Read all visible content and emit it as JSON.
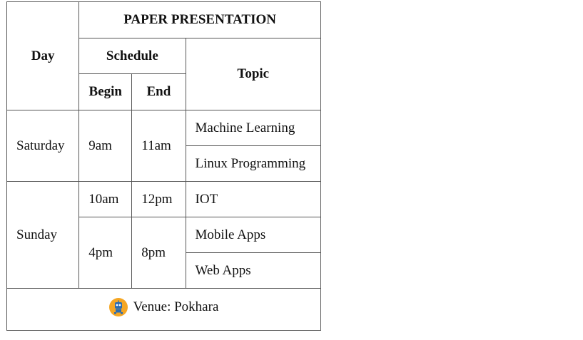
{
  "table": {
    "title": "PAPER PRESENTATION",
    "headers": {
      "day": "Day",
      "schedule": "Schedule",
      "begin": "Begin",
      "end": "End",
      "topic": "Topic"
    },
    "saturday": {
      "day": "Saturday",
      "begin": "9am",
      "end": "11am",
      "topics": [
        "Machine Learning",
        "Linux Programming"
      ]
    },
    "sunday": {
      "day": "Sunday",
      "slots": [
        {
          "begin": "10am",
          "end": "12pm",
          "topics": [
            "IOT"
          ]
        },
        {
          "begin": "4pm",
          "end": "8pm",
          "topics": [
            "Mobile Apps",
            "Web Apps"
          ]
        }
      ]
    },
    "footer": {
      "icon": "robot-icon",
      "venue": "Venue: Pokhara"
    }
  },
  "colors": {
    "border": "#555555",
    "icon_bg": "#f5a623",
    "icon_fg": "#2b6cb0"
  }
}
